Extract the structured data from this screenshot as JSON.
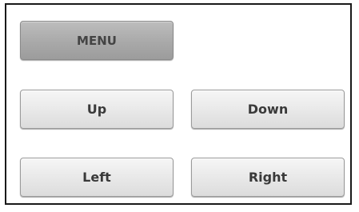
{
  "panel": {
    "menu_label": "MENU",
    "up_label": "Up",
    "down_label": "Down",
    "left_label": "Left",
    "right_label": "Right"
  },
  "colors": {
    "frame_border": "#1a1a1a",
    "button_face": "#e9e9e9",
    "menu_face": "#a9a9a9",
    "label_text": "#3a3a3a"
  }
}
